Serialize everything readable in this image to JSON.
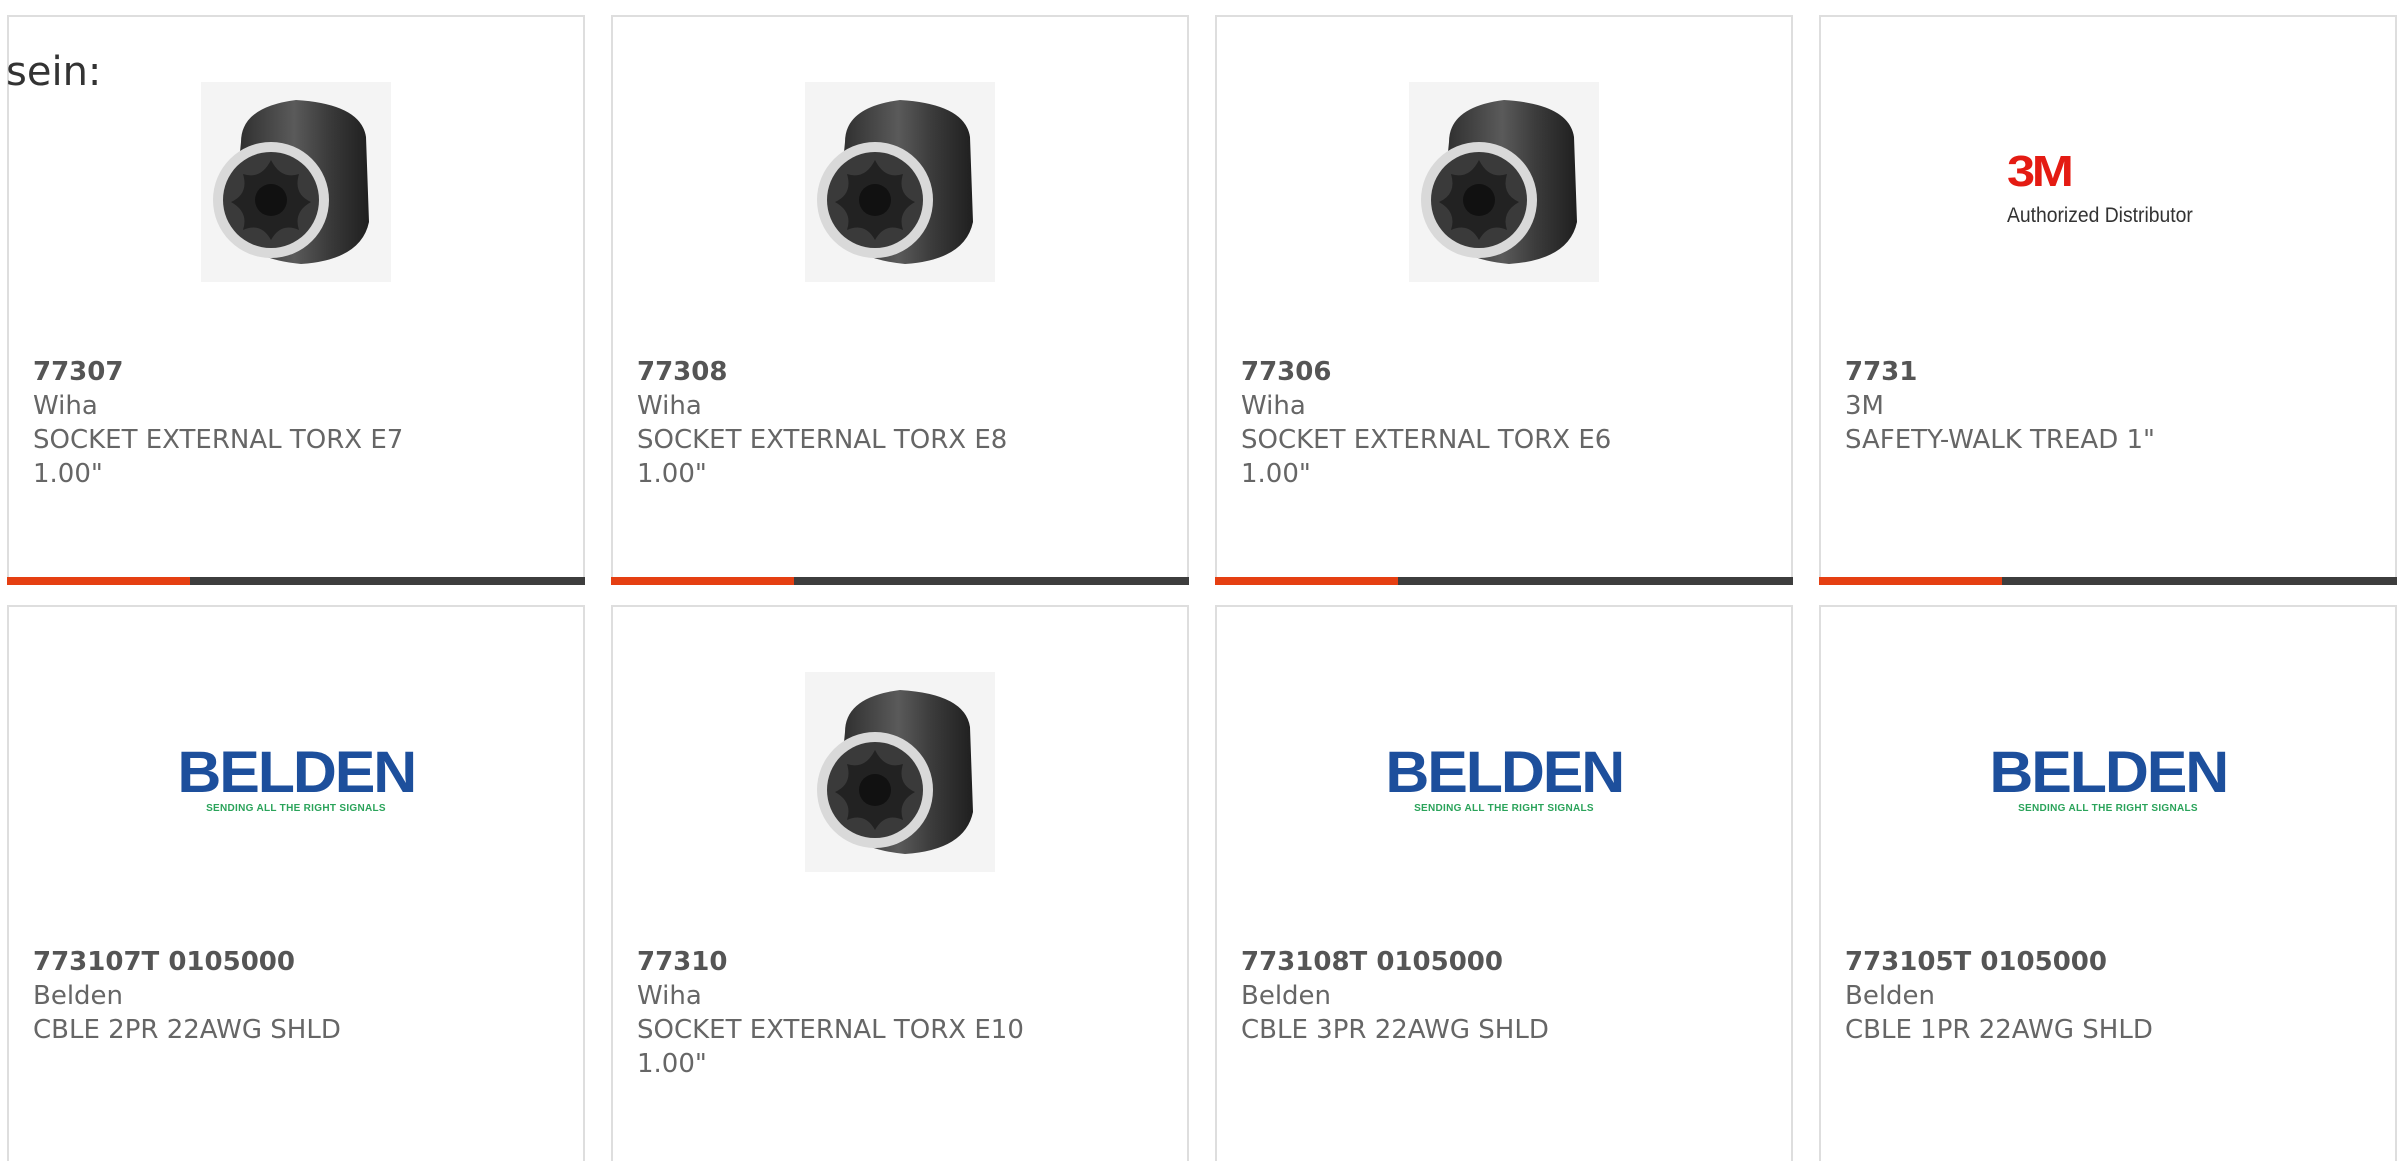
{
  "heading": "sein:",
  "colors": {
    "accent": "#e53f12",
    "bar": "#3d3d3d",
    "text": "#666666",
    "belden_blue": "#1d4f9c",
    "belden_green": "#2aa35a",
    "brand_3m": "#e41b13"
  },
  "products": [
    {
      "part_number": "77307",
      "brand": "Wiha",
      "description": "SOCKET EXTERNAL TORX E7",
      "extra": "1.00\"",
      "image": "socket-image"
    },
    {
      "part_number": "77308",
      "brand": "Wiha",
      "description": "SOCKET EXTERNAL TORX E8",
      "extra": "1.00\"",
      "image": "socket-image"
    },
    {
      "part_number": "77306",
      "brand": "Wiha",
      "description": "SOCKET EXTERNAL TORX E6",
      "extra": "1.00\"",
      "image": "socket-image"
    },
    {
      "part_number": "7731",
      "brand": "3M",
      "description": "SAFETY-WALK TREAD 1\"",
      "extra": "",
      "image": "3m-logo",
      "logo_mark": "3M",
      "logo_sub": "Authorized Distributor"
    },
    {
      "part_number": "773107T 0105000",
      "brand": "Belden",
      "description": "CBLE 2PR 22AWG SHLD",
      "extra": "",
      "image": "belden-logo",
      "logo_mark": "BELDEN",
      "logo_sub": "SENDING ALL THE RIGHT SIGNALS"
    },
    {
      "part_number": "77310",
      "brand": "Wiha",
      "description": "SOCKET EXTERNAL TORX E10",
      "extra": "1.00\"",
      "image": "socket-image"
    },
    {
      "part_number": "773108T 0105000",
      "brand": "Belden",
      "description": "CBLE 3PR 22AWG SHLD",
      "extra": "",
      "image": "belden-logo",
      "logo_mark": "BELDEN",
      "logo_sub": "SENDING ALL THE RIGHT SIGNALS"
    },
    {
      "part_number": "773105T 0105000",
      "brand": "Belden",
      "description": "CBLE 1PR 22AWG SHLD",
      "extra": "",
      "image": "belden-logo",
      "logo_mark": "BELDEN",
      "logo_sub": "SENDING ALL THE RIGHT SIGNALS"
    }
  ]
}
